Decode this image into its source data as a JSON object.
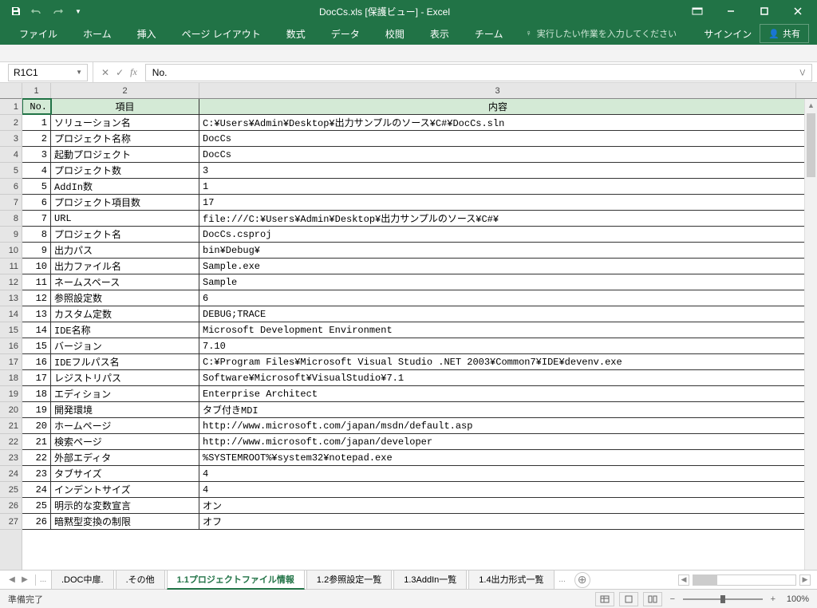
{
  "title_bar": {
    "title": "DocCs.xls [保護ビュー] - Excel"
  },
  "ribbon": {
    "tabs": [
      "ファイル",
      "ホーム",
      "挿入",
      "ページ レイアウト",
      "数式",
      "データ",
      "校閲",
      "表示",
      "チーム"
    ],
    "tell_me": "実行したい作業を入力してください",
    "sign_in": "サインイン",
    "share": "共有"
  },
  "formula_bar": {
    "name_box": "R1C1",
    "formula": "No."
  },
  "grid": {
    "col_labels": [
      "1",
      "2",
      "3"
    ],
    "row_labels": [
      "1",
      "2",
      "3",
      "4",
      "5",
      "6",
      "7",
      "8",
      "9",
      "10",
      "11",
      "12",
      "13",
      "14",
      "15",
      "16",
      "17",
      "18",
      "19",
      "20",
      "21",
      "22",
      "23",
      "24",
      "25",
      "26",
      "27"
    ],
    "headers": [
      "No.",
      "項目",
      "内容"
    ],
    "rows": [
      [
        "1",
        "ソリューション名",
        "C:¥Users¥Admin¥Desktop¥出力サンプルのソース¥C#¥DocCs.sln"
      ],
      [
        "2",
        "プロジェクト名称",
        "DocCs"
      ],
      [
        "3",
        "起動プロジェクト",
        "DocCs"
      ],
      [
        "4",
        "プロジェクト数",
        "3"
      ],
      [
        "5",
        "AddIn数",
        "1"
      ],
      [
        "6",
        "プロジェクト項目数",
        "17"
      ],
      [
        "7",
        "URL",
        "file:///C:¥Users¥Admin¥Desktop¥出力サンプルのソース¥C#¥"
      ],
      [
        "8",
        "プロジェクト名",
        "DocCs.csproj"
      ],
      [
        "9",
        "出力パス",
        "bin¥Debug¥"
      ],
      [
        "10",
        "出力ファイル名",
        "Sample.exe"
      ],
      [
        "11",
        "ネームスペース",
        "Sample"
      ],
      [
        "12",
        "参照設定数",
        "6"
      ],
      [
        "13",
        "カスタム定数",
        "DEBUG;TRACE"
      ],
      [
        "14",
        "IDE名称",
        "Microsoft Development Environment"
      ],
      [
        "15",
        "バージョン",
        "7.10"
      ],
      [
        "16",
        "IDEフルパス名",
        "C:¥Program Files¥Microsoft Visual Studio .NET 2003¥Common7¥IDE¥devenv.exe"
      ],
      [
        "17",
        "レジストリパス",
        "Software¥Microsoft¥VisualStudio¥7.1"
      ],
      [
        "18",
        "エディション",
        "Enterprise Architect"
      ],
      [
        "19",
        "開発環境",
        "タブ付きMDI"
      ],
      [
        "20",
        "ホームページ",
        "http://www.microsoft.com/japan/msdn/default.asp"
      ],
      [
        "21",
        "検索ページ",
        "http://www.microsoft.com/japan/developer"
      ],
      [
        "22",
        "外部エディタ",
        "%SYSTEMROOT%¥system32¥notepad.exe"
      ],
      [
        "23",
        "タブサイズ",
        "4"
      ],
      [
        "24",
        "インデントサイズ",
        "4"
      ],
      [
        "25",
        "明示的な変数宣言",
        "オン"
      ],
      [
        "26",
        "暗黙型変換の制限",
        "オフ"
      ]
    ]
  },
  "sheet_tabs": {
    "ellipsis": "...",
    "tabs": [
      ".DOC中扉.",
      ".その他",
      "1.1プロジェクトファイル情報",
      "1.2参照設定一覧",
      "1.3AddIn一覧",
      "1.4出力形式一覧"
    ],
    "more": "..."
  },
  "status_bar": {
    "status": "準備完了",
    "zoom": "100%"
  }
}
